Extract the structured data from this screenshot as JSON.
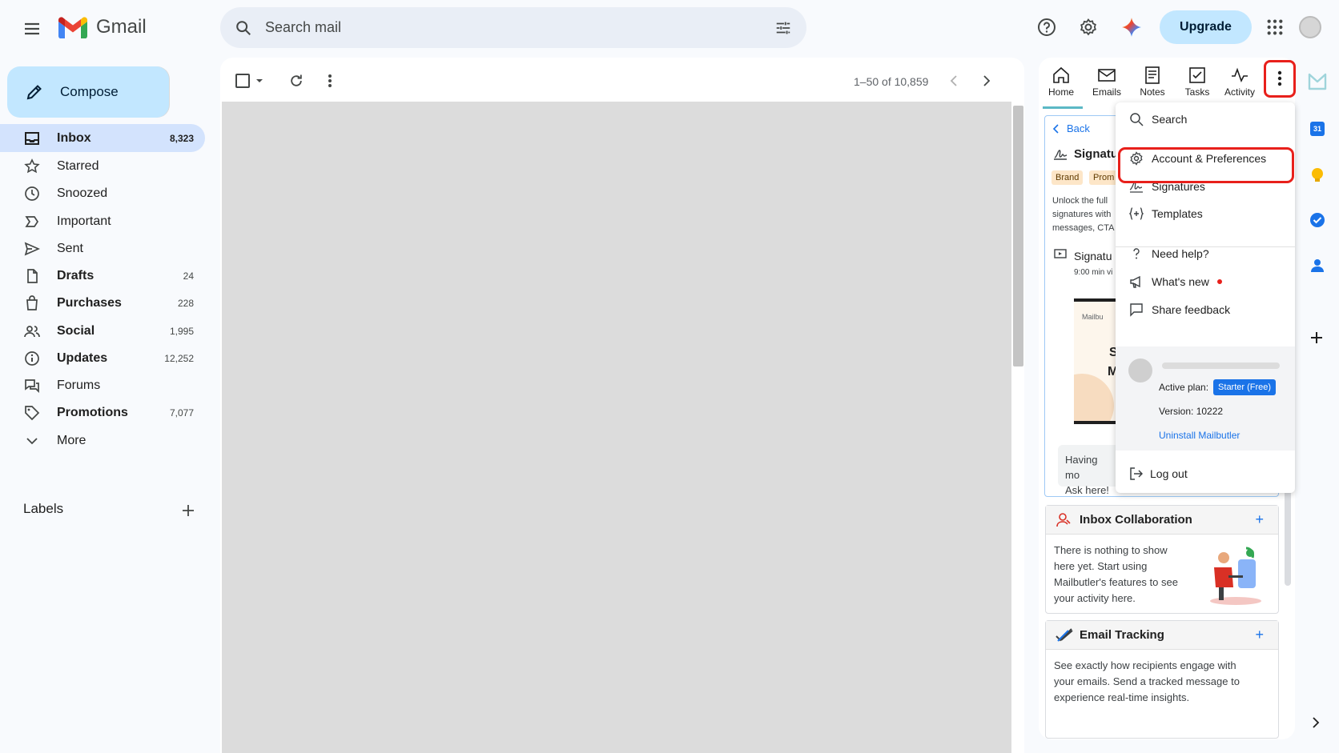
{
  "header": {
    "app_name": "Gmail",
    "search_placeholder": "Search mail",
    "upgrade_label": "Upgrade"
  },
  "sidebar": {
    "compose_label": "Compose",
    "items": [
      {
        "label": "Inbox",
        "count": "8,323",
        "icon": "inbox-icon"
      },
      {
        "label": "Starred",
        "count": "",
        "icon": "star-icon"
      },
      {
        "label": "Snoozed",
        "count": "",
        "icon": "clock-icon"
      },
      {
        "label": "Important",
        "count": "",
        "icon": "important-icon"
      },
      {
        "label": "Sent",
        "count": "",
        "icon": "send-icon"
      },
      {
        "label": "Drafts",
        "count": "24",
        "icon": "draft-icon"
      },
      {
        "label": "Purchases",
        "count": "228",
        "icon": "shopping-bag-icon"
      },
      {
        "label": "Social",
        "count": "1,995",
        "icon": "people-icon"
      },
      {
        "label": "Updates",
        "count": "12,252",
        "icon": "info-icon"
      },
      {
        "label": "Forums",
        "count": "",
        "icon": "forum-icon"
      },
      {
        "label": "Promotions",
        "count": "7,077",
        "icon": "tag-icon"
      },
      {
        "label": "More",
        "count": "",
        "icon": "chevron-down-icon"
      }
    ],
    "labels_title": "Labels"
  },
  "toolbar": {
    "pagination": "1–50 of 10,859"
  },
  "panel": {
    "tabs": [
      {
        "label": "Home"
      },
      {
        "label": "Emails"
      },
      {
        "label": "Notes"
      },
      {
        "label": "Tasks"
      },
      {
        "label": "Activity"
      }
    ],
    "back_label": "Back",
    "signature_title": "Signatu",
    "tags": [
      "Brand",
      "Prom"
    ],
    "signature_desc": [
      "Unlock the full",
      "signatures with",
      "messages, CTA"
    ],
    "video_title": "Signatu",
    "video_meta": "9:00 min vi",
    "thumb_logo": "Mailbu",
    "thumb_letters": [
      "S",
      "M"
    ],
    "help_bubble": [
      "Having mo",
      "Ask here!"
    ],
    "cards": [
      {
        "title": "Inbox Collaboration",
        "body": "There is nothing to show here yet. Start using Mailbutler's features to see your activity here."
      },
      {
        "title": "Email Tracking",
        "body": "See exactly how recipients engage with your emails. Send a tracked message to experience real-time insights."
      }
    ]
  },
  "menu": {
    "items": [
      {
        "label": "Search",
        "icon": "search-icon"
      },
      {
        "label": "Account & Preferences",
        "icon": "gear-icon"
      },
      {
        "label": "Signatures",
        "icon": "signature-icon"
      },
      {
        "label": "Templates",
        "icon": "template-icon"
      },
      {
        "label": "Need help?",
        "icon": "question-icon"
      },
      {
        "label": "What's new",
        "icon": "megaphone-icon"
      },
      {
        "label": "Share feedback",
        "icon": "feedback-icon"
      }
    ],
    "account": {
      "plan_label": "Active plan:",
      "plan_value": "Starter (Free)",
      "version": "Version: 10222",
      "uninstall": "Uninstall Mailbutler"
    },
    "logout_label": "Log out"
  },
  "side_apps": {
    "calendar_day": "31"
  },
  "colors": {
    "highlight_red": "#e8201b",
    "accent_blue": "#1a73e8",
    "compose_blue": "#c2e7ff"
  }
}
